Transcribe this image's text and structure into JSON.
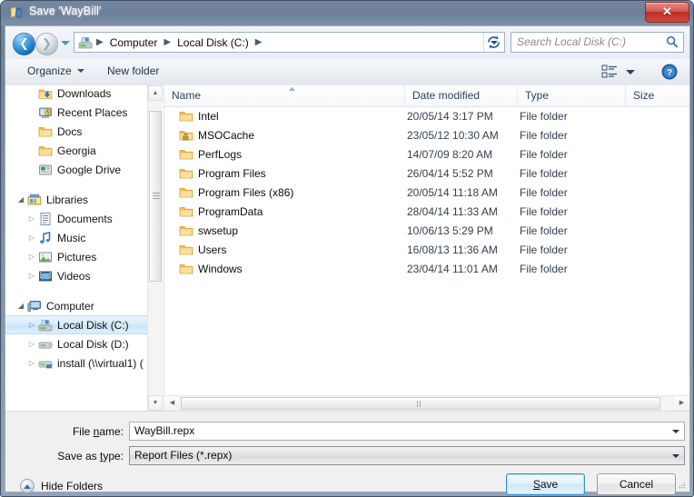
{
  "window": {
    "title": "Save 'WayBill'",
    "app_icon": "report-designer-icon",
    "close_label": "✕"
  },
  "addressbar": {
    "back_tooltip": "Back",
    "forward_tooltip": "Forward",
    "recent_locations": "▼",
    "drive_icon": "local-disk-icon",
    "crumbs": [
      "Computer",
      "Local Disk (C:)"
    ],
    "separator": "▶",
    "refresh_icon": "refresh-icon"
  },
  "search": {
    "placeholder": "Search Local Disk (C:)",
    "icon": "search-icon"
  },
  "toolbar": {
    "organize_label": "Organize",
    "new_folder_label": "New folder",
    "views_icon": "view-list-icon",
    "help_icon": "help-icon"
  },
  "navpane": {
    "items": [
      {
        "label": "Downloads",
        "icon": "downloads-folder-icon",
        "indent": 2,
        "twisty": "",
        "selected": false
      },
      {
        "label": "Recent Places",
        "icon": "recent-places-icon",
        "indent": 2,
        "twisty": "",
        "selected": false
      },
      {
        "label": "Docs",
        "icon": "folder-icon",
        "indent": 2,
        "twisty": "",
        "selected": false
      },
      {
        "label": "Georgia",
        "icon": "folder-icon",
        "indent": 2,
        "twisty": "",
        "selected": false
      },
      {
        "label": "Google Drive",
        "icon": "google-drive-icon",
        "indent": 2,
        "twisty": "",
        "selected": false
      },
      {
        "label": "Libraries",
        "icon": "libraries-icon",
        "indent": 1,
        "twisty": "◢",
        "selected": false
      },
      {
        "label": "Documents",
        "icon": "documents-library-icon",
        "indent": 2,
        "twisty": "▷",
        "selected": false
      },
      {
        "label": "Music",
        "icon": "music-library-icon",
        "indent": 2,
        "twisty": "▷",
        "selected": false
      },
      {
        "label": "Pictures",
        "icon": "pictures-library-icon",
        "indent": 2,
        "twisty": "▷",
        "selected": false
      },
      {
        "label": "Videos",
        "icon": "videos-library-icon",
        "indent": 2,
        "twisty": "▷",
        "selected": false
      },
      {
        "label": "Computer",
        "icon": "computer-icon",
        "indent": 1,
        "twisty": "◢",
        "selected": false
      },
      {
        "label": "Local Disk (C:)",
        "icon": "local-disk-icon",
        "indent": 2,
        "twisty": "▷",
        "selected": true
      },
      {
        "label": "Local Disk (D:)",
        "icon": "drive-icon",
        "indent": 2,
        "twisty": "▷",
        "selected": false
      },
      {
        "label": "install (\\\\virtual1) (",
        "icon": "network-drive-icon",
        "indent": 2,
        "twisty": "▷",
        "selected": false
      }
    ]
  },
  "filelist": {
    "columns": [
      "Name",
      "Date modified",
      "Type",
      "Size"
    ],
    "sort_column": "Name",
    "sort_direction": "ascending",
    "rows": [
      {
        "name": "Intel",
        "icon": "folder-icon",
        "date": "20/05/14 3:17 PM",
        "type": "File folder",
        "size": ""
      },
      {
        "name": "MSOCache",
        "icon": "folder-locked-icon",
        "date": "23/05/12 10:30 AM",
        "type": "File folder",
        "size": ""
      },
      {
        "name": "PerfLogs",
        "icon": "folder-icon",
        "date": "14/07/09 8:20 AM",
        "type": "File folder",
        "size": ""
      },
      {
        "name": "Program Files",
        "icon": "folder-icon",
        "date": "26/04/14 5:52 PM",
        "type": "File folder",
        "size": ""
      },
      {
        "name": "Program Files (x86)",
        "icon": "folder-icon",
        "date": "20/05/14 11:18 AM",
        "type": "File folder",
        "size": ""
      },
      {
        "name": "ProgramData",
        "icon": "folder-icon",
        "date": "28/04/14 11:33 AM",
        "type": "File folder",
        "size": ""
      },
      {
        "name": "swsetup",
        "icon": "folder-icon",
        "date": "10/06/13 5:29 PM",
        "type": "File folder",
        "size": ""
      },
      {
        "name": "Users",
        "icon": "folder-icon",
        "date": "16/08/13 11:36 AM",
        "type": "File folder",
        "size": ""
      },
      {
        "name": "Windows",
        "icon": "folder-icon",
        "date": "23/04/14 11:01 AM",
        "type": "File folder",
        "size": ""
      }
    ]
  },
  "form": {
    "filename_label_pre": "File ",
    "filename_label_accel": "n",
    "filename_label_post": "ame:",
    "filename_value": "WayBill.repx",
    "savetype_label_pre": "Save as ",
    "savetype_label_accel": "t",
    "savetype_label_post": "ype:",
    "savetype_value": "Report Files (*.repx)"
  },
  "footer": {
    "hide_folders_label": "Hide Folders",
    "save_label_pre": "",
    "save_label_accel": "S",
    "save_label_post": "ave",
    "cancel_label": "Cancel"
  },
  "colors": {
    "titlebar": "#6e8099",
    "close_red": "#bb2e26",
    "selection_blue": "#c7e5fa",
    "default_button_border": "#3c8ed0",
    "folder_yellow": "#f5c967",
    "crumb_text": "#0a0a0a"
  }
}
